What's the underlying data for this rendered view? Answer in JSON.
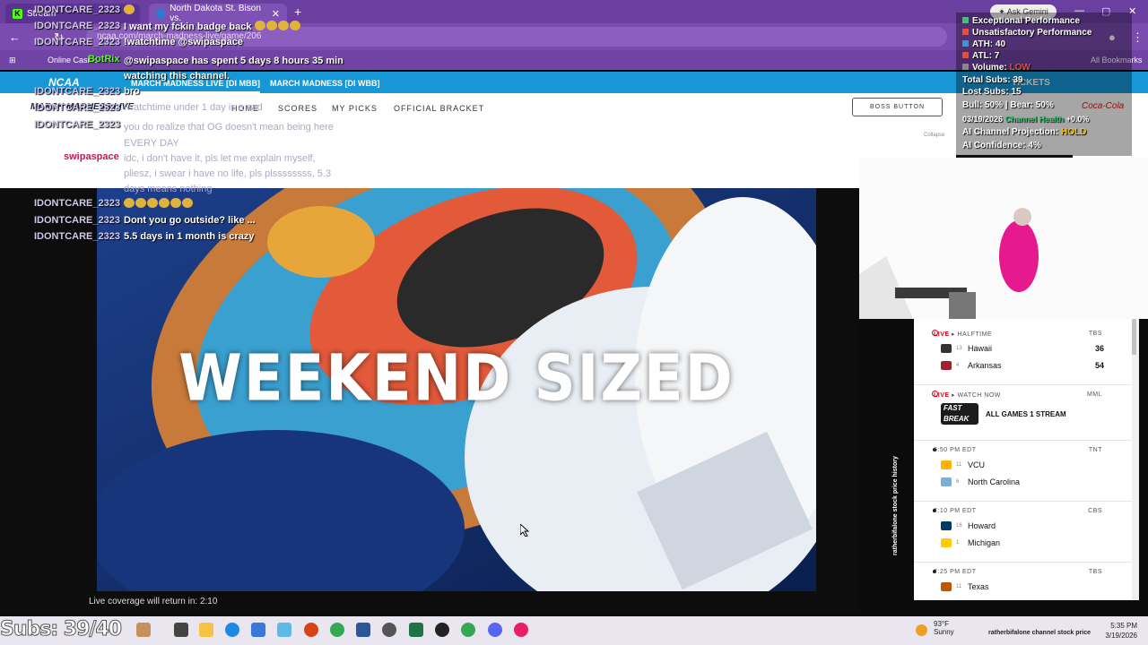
{
  "browser": {
    "tab1_label": "Stream",
    "tab2_label": "North Dakota St. Bison vs.",
    "new_tab": "+",
    "ask_gemini": "✦ Ask Gemini",
    "url": "ncaa.com/march-madness-live/game/206",
    "bookmarks": [
      "Online Casino",
      "All Bookmarks"
    ]
  },
  "ncaa_nav": {
    "logo": "NCAA",
    "tabs": [
      "MARCH MADNESS LIVE [DI MBB]",
      "MARCH MADNESS [DI WBB]"
    ],
    "tickets": "TICKETS"
  },
  "site_nav": {
    "logo": "MARCH MADNESS LIVE",
    "items": [
      "HOME",
      "SCORES",
      "MY PICKS",
      "OFFICIAL BRACKET"
    ],
    "boss_button": "BOSS BUTTON",
    "sponsor": "Coca-Cola",
    "collapse": "Collapse"
  },
  "video": {
    "headline": "WEEKEND SIZED",
    "live_return": "Live coverage will return in: 2:10"
  },
  "chat": [
    {
      "user": "IDONTCARE_2323",
      "text": "🏆🏆",
      "emotes": 1
    },
    {
      "user": "IDONTCARE_2323",
      "text": "I want my fckin badge back",
      "emotes": 4
    },
    {
      "user": "IDONTCARE_2323",
      "text": "!watchtime @swipaspace",
      "emotes": 0
    },
    {
      "user": "BotRix",
      "text": "@swipaspace has spent 5 days 8 hours 35 min watching this channel.",
      "emotes": 0
    },
    {
      "user": "IDONTCARE_2323",
      "text": "bro",
      "emotes": 0
    },
    {
      "user": "IDONTCARE_2323",
      "text": "!watchtime under 1 day is a sad",
      "emotes": 0
    },
    {
      "user": "IDONTCARE_2323",
      "text": "you do realize that OG doesn't mean being here EVERY DAY",
      "emotes": 0
    },
    {
      "user": "swipaspace",
      "text": "idc, i don't have it, pls let me explain myself, pliesz, i swear i have no life, pls plssssssss, 5.3 days means nothing",
      "emotes": 0
    },
    {
      "user": "IDONTCARE_2323",
      "text": "",
      "emotes": 6
    },
    {
      "user": "IDONTCARE_2323",
      "text": "Dont you go outside? like ...",
      "emotes": 0
    },
    {
      "user": "IDONTCARE_2323",
      "text": "5.5 days in 1 month is crazy",
      "emotes": 0
    }
  ],
  "stats": {
    "items": [
      {
        "label": "Exceptional Performance",
        "color": "#2ecc71"
      },
      {
        "label": "Unsatisfactory Performance",
        "color": "#e74c3c"
      },
      {
        "label": "ATH: 40",
        "color": "#3498db"
      },
      {
        "label": "ATL: 7",
        "color": "#e74c3c"
      },
      {
        "label": "Volume: ",
        "color": "#888888",
        "value": "LOW",
        "value_color": "#e74c3c"
      }
    ],
    "total_subs": "Total Subs: 39",
    "lost_subs": "Lost Subs: 15",
    "bull_bear": "Bull: 50% | Bear: 50%",
    "date": "03/19/2026",
    "health_label": "Channel Health",
    "health_value": "+0.0%",
    "projection_label": "AI Channel Projection: ",
    "projection_value": "HOLD",
    "confidence": "AI Confidence: 4%"
  },
  "scoreboard": [
    {
      "status_prefix": "LIVE",
      "status": "HALFTIME",
      "network": "TBS",
      "fastbreak": false,
      "teams": [
        {
          "seed": "13",
          "name": "Hawaii",
          "score": "36",
          "color": "#333333"
        },
        {
          "seed": "4",
          "name": "Arkansas",
          "score": "54",
          "color": "#9d2235"
        }
      ]
    },
    {
      "status_prefix": "LIVE",
      "status": "WATCH NOW",
      "network": "MML",
      "fastbreak": true,
      "fastbreak_text": "FAST BREAK",
      "teams": [
        {
          "seed": "",
          "name": "ALL GAMES 1 STREAM",
          "score": "",
          "color": "#1b1b1b"
        }
      ]
    },
    {
      "status_prefix": "",
      "status": "6:50 PM EDT",
      "network": "TNT",
      "fastbreak": false,
      "teams": [
        {
          "seed": "11",
          "name": "VCU",
          "score": "",
          "color": "#ffb300"
        },
        {
          "seed": "6",
          "name": "North Carolina",
          "score": "",
          "color": "#7bafd4"
        }
      ]
    },
    {
      "status_prefix": "",
      "status": "7:10 PM EDT",
      "network": "CBS",
      "fastbreak": false,
      "teams": [
        {
          "seed": "16",
          "name": "Howard",
          "score": "",
          "color": "#003a63"
        },
        {
          "seed": "1",
          "name": "Michigan",
          "score": "",
          "color": "#ffcb05"
        }
      ]
    },
    {
      "status_prefix": "",
      "status": "7:25 PM EDT",
      "network": "TBS",
      "fastbreak": false,
      "teams": [
        {
          "seed": "11",
          "name": "Texas",
          "score": "",
          "color": "#bf5700"
        }
      ]
    }
  ],
  "stock_label": "ratherbifalone stock price history",
  "taskbar": {
    "subs": "Subs: 39/40",
    "temp": "93°F",
    "condition": "Sunny",
    "tray_label": "ratherbifalone channel stock price",
    "time": "5:35 PM",
    "date": "3/19/2026"
  }
}
